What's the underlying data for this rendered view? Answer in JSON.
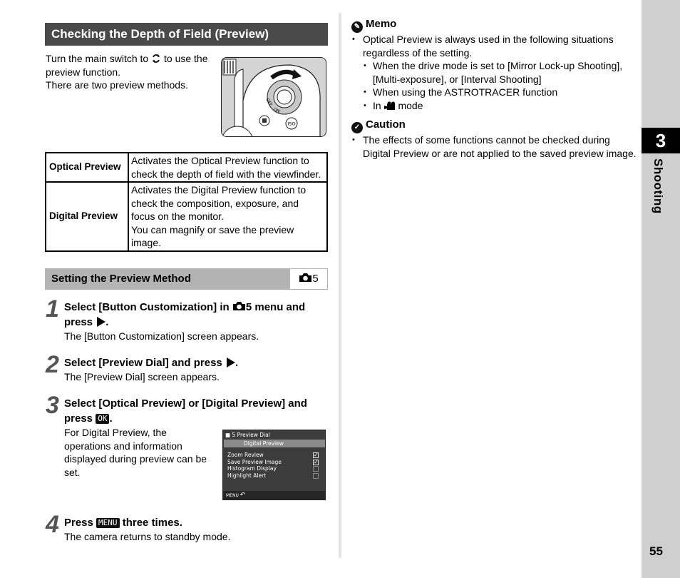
{
  "section": {
    "title": "Checking the Depth of Field (Preview)",
    "intro": [
      "Turn the main switch to",
      "to use the",
      "preview function.",
      "There are two preview methods."
    ],
    "switch_icon": "preview-switch-icon"
  },
  "illustration": {
    "dial_labels": [
      "OFF",
      "ON"
    ],
    "buttons": [
      "exposure-comp",
      "ISO"
    ]
  },
  "methods": [
    {
      "term": "Optical Preview",
      "description": [
        "Activates the Optical Preview function to",
        "check the depth of field with the viewfinder."
      ]
    },
    {
      "term": "Digital Preview",
      "description": [
        "Activates the Digital Preview function to",
        "check the composition, exposure, and",
        "focus on the monitor.",
        "You can magnify or save the preview",
        "image."
      ]
    }
  ],
  "subsection": {
    "title": "Setting the Preview Method",
    "menu_ref": "5",
    "menu_icon": "camera-icon"
  },
  "steps": [
    {
      "num": "1",
      "title_parts": [
        "Select [Button Customization] in",
        "5 menu and",
        "press"
      ],
      "body": "The [Button Customization] screen appears."
    },
    {
      "num": "2",
      "title_parts": [
        "Select [Preview Dial] and press"
      ],
      "body": "The [Preview Dial] screen appears."
    },
    {
      "num": "3",
      "title_parts": [
        "Select [Optical Preview] or [Digital Preview] and",
        "press"
      ],
      "key": "OK",
      "body": [
        "For Digital Preview, the",
        "operations and information",
        "displayed during preview can be",
        "set."
      ]
    },
    {
      "num": "4",
      "title_parts": [
        "Press",
        "three times."
      ],
      "key": "MENU",
      "body": "The camera returns to standby mode."
    }
  ],
  "screen": {
    "title": "5 Preview Dial",
    "selected": "Digital Preview",
    "items": [
      {
        "label": "Zoom Review",
        "checked": true
      },
      {
        "label": "Save Preview Image",
        "checked": true
      },
      {
        "label": "Histogram Display",
        "checked": false
      },
      {
        "label": "Highlight Alert",
        "checked": false
      }
    ],
    "footer": "MENU"
  },
  "memo": {
    "heading": "Memo",
    "bullet": [
      "Optical Preview is always used in the following situations",
      "regardless of the setting."
    ],
    "sub": [
      [
        "When the drive mode is set to [Mirror Lock-up Shooting],",
        "[Multi-exposure], or [Interval Shooting]"
      ],
      [
        "When using the ASTROTRACER function"
      ],
      [
        "In",
        "mode"
      ]
    ]
  },
  "caution": {
    "heading": "Caution",
    "bullet": [
      "The effects of some functions cannot be checked during",
      "Digital Preview or are not applied to the saved preview image."
    ]
  },
  "tab": {
    "chapter": "3",
    "label": "Shooting",
    "page": "55"
  }
}
